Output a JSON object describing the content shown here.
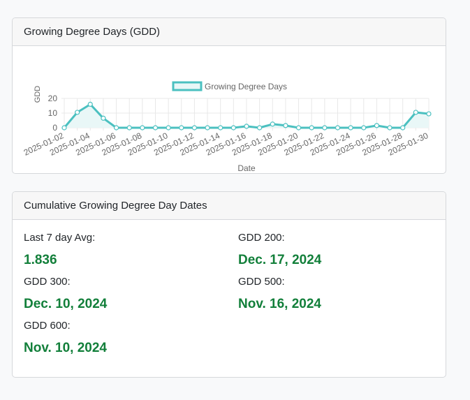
{
  "gdd_card": {
    "title": "Growing Degree Days (GDD)"
  },
  "chart_data": {
    "type": "area",
    "title": "",
    "xlabel": "Date",
    "ylabel": "GDD",
    "ylim": [
      0,
      20
    ],
    "yticks": [
      0,
      10,
      20
    ],
    "legend": "top-center",
    "grid": true,
    "x": [
      "2025-01-02",
      "2025-01-03",
      "2025-01-04",
      "2025-01-05",
      "2025-01-06",
      "2025-01-07",
      "2025-01-08",
      "2025-01-09",
      "2025-01-10",
      "2025-01-11",
      "2025-01-12",
      "2025-01-13",
      "2025-01-14",
      "2025-01-15",
      "2025-01-16",
      "2025-01-17",
      "2025-01-18",
      "2025-01-19",
      "2025-01-20",
      "2025-01-21",
      "2025-01-22",
      "2025-01-23",
      "2025-01-24",
      "2025-01-25",
      "2025-01-26",
      "2025-01-27",
      "2025-01-28",
      "2025-01-29",
      "2025-01-30"
    ],
    "tick_labels": [
      "2025-01-02",
      "2025-01-04",
      "2025-01-06",
      "2025-01-08",
      "2025-01-10",
      "2025-01-12",
      "2025-01-14",
      "2025-01-16",
      "2025-01-18",
      "2025-01-20",
      "2025-01-22",
      "2025-01-24",
      "2025-01-26",
      "2025-01-28",
      "2025-01-30"
    ],
    "series": [
      {
        "name": "Growing Degree Days",
        "values": [
          0,
          10.5,
          16,
          6.5,
          0,
          0,
          0,
          0,
          0,
          0,
          0,
          0,
          0,
          0,
          1,
          0,
          2.5,
          1.5,
          0,
          0,
          0,
          0,
          0,
          0,
          1.5,
          0,
          0,
          10.5,
          9.5
        ]
      }
    ]
  },
  "colors": {
    "line": "#4bc0c0",
    "fill": "#e9f7f7",
    "value": "#127f3a"
  },
  "cum_card": {
    "title": "Cumulative Growing Degree Day Dates",
    "items": [
      {
        "label": "Last 7 day Avg:",
        "value": "1.836"
      },
      {
        "label": "GDD 200:",
        "value": "Dec. 17, 2024"
      },
      {
        "label": "GDD 300:",
        "value": "Dec. 10, 2024"
      },
      {
        "label": "GDD 500:",
        "value": "Nov. 16, 2024"
      },
      {
        "label": "GDD 600:",
        "value": "Nov. 10, 2024"
      }
    ]
  }
}
